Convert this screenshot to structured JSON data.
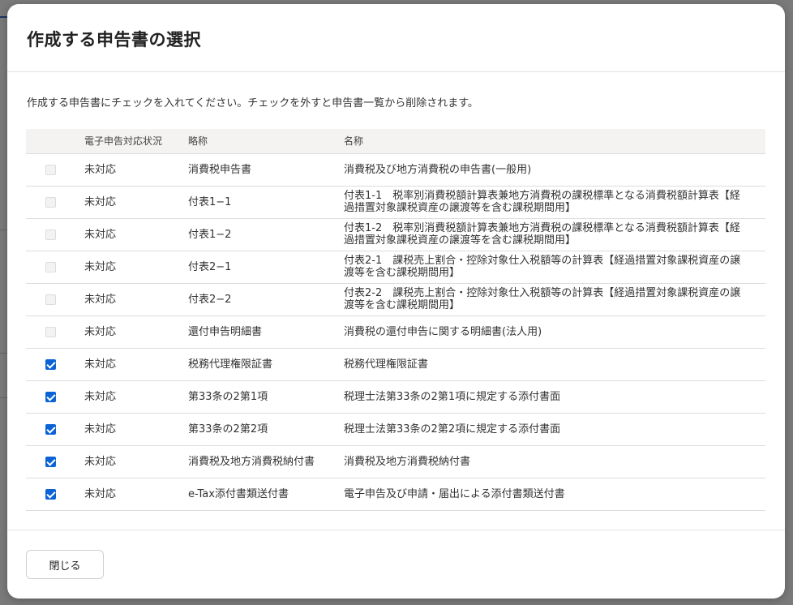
{
  "dialog": {
    "title": "作成する申告書の選択",
    "instruction": "作成する申告書にチェックを入れてください。チェックを外すと申告書一覧から削除されます。",
    "close_label": "閉じる"
  },
  "table": {
    "headers": {
      "check": "",
      "status": "電子申告対応状況",
      "abbr": "略称",
      "name": "名称"
    },
    "rows": [
      {
        "checked": false,
        "disabled": true,
        "status": "未対応",
        "abbr": "消費税申告書",
        "name": "消費税及び地方消費税の申告書(一般用)"
      },
      {
        "checked": false,
        "disabled": true,
        "status": "未対応",
        "abbr": "付表1−1",
        "name": "付表1-1　税率別消費税額計算表兼地方消費税の課税標準となる消費税額計算表【経過措置対象課税資産の譲渡等を含む課税期間用】"
      },
      {
        "checked": false,
        "disabled": true,
        "status": "未対応",
        "abbr": "付表1−2",
        "name": "付表1-2　税率別消費税額計算表兼地方消費税の課税標準となる消費税額計算表【経過措置対象課税資産の譲渡等を含む課税期間用】"
      },
      {
        "checked": false,
        "disabled": true,
        "status": "未対応",
        "abbr": "付表2−1",
        "name": "付表2-1　課税売上割合・控除対象仕入税額等の計算表【経過措置対象課税資産の譲渡等を含む課税期間用】"
      },
      {
        "checked": false,
        "disabled": true,
        "status": "未対応",
        "abbr": "付表2−2",
        "name": "付表2-2　課税売上割合・控除対象仕入税額等の計算表【経過措置対象課税資産の譲渡等を含む課税期間用】"
      },
      {
        "checked": false,
        "disabled": true,
        "status": "未対応",
        "abbr": "還付申告明細書",
        "name": "消費税の還付申告に関する明細書(法人用)"
      },
      {
        "checked": true,
        "disabled": false,
        "status": "未対応",
        "abbr": "税務代理権限証書",
        "name": "税務代理権限証書"
      },
      {
        "checked": true,
        "disabled": false,
        "status": "未対応",
        "abbr": "第33条の2第1項",
        "name": "税理士法第33条の2第1項に規定する添付書面"
      },
      {
        "checked": true,
        "disabled": false,
        "status": "未対応",
        "abbr": "第33条の2第2項",
        "name": "税理士法第33条の2第2項に規定する添付書面"
      },
      {
        "checked": true,
        "disabled": false,
        "status": "未対応",
        "abbr": "消費税及地方消費税納付書",
        "name": "消費税及地方消費税納付書"
      },
      {
        "checked": true,
        "disabled": false,
        "status": "未対応",
        "abbr": "e-Tax添付書類送付書",
        "name": "電子申告及び申請・届出による添付書類送付書"
      }
    ]
  },
  "colors": {
    "accent": "#0b63d6",
    "header_bg": "#f5f3f2",
    "overlay": "#7a7a7a"
  }
}
